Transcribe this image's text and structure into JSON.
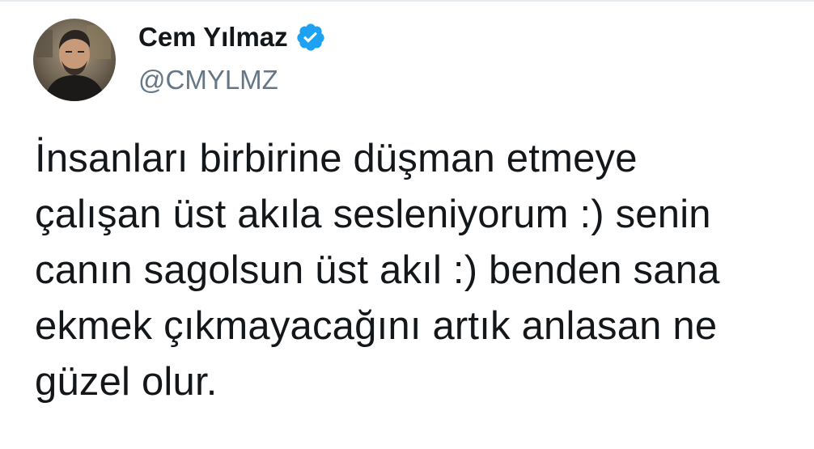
{
  "author": {
    "display_name": "Cem Yılmaz",
    "handle": "@CMYLMZ",
    "verified_icon": "verified-badge-icon",
    "verified_color": "#1da1f2"
  },
  "tweet": {
    "lines": [
      "İnsanları birbirine düşman etmeye",
      "çalışan üst akıla sesleniyorum :) senin",
      "canın sagolsun üst akıl :) benden sana",
      "ekmek çıkmayacağını artık anlasan ne",
      "güzel olur."
    ]
  },
  "colors": {
    "text": "#14171a",
    "secondary_text": "#657786",
    "background": "#ffffff"
  }
}
